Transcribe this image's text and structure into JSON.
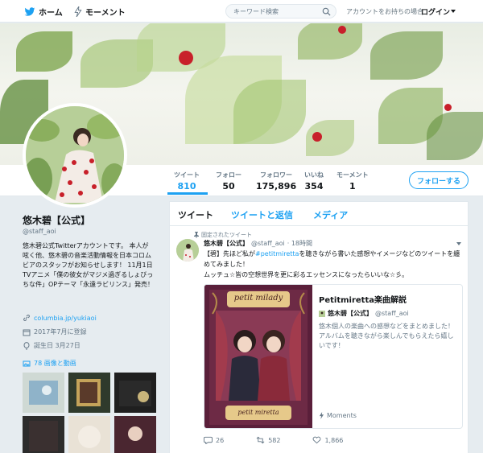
{
  "nav": {
    "home_label": "ホーム",
    "moments_label": "モーメント",
    "search_placeholder": "キーワード検索",
    "login_prompt": "アカウントをお持ちの場合",
    "login_label": "ログイン"
  },
  "stats": [
    {
      "label": "ツイート",
      "value": "810"
    },
    {
      "label": "フォロー",
      "value": "50"
    },
    {
      "label": "フォロワー",
      "value": "175,896"
    },
    {
      "label": "いいね",
      "value": "354"
    },
    {
      "label": "モーメント",
      "value": "1"
    }
  ],
  "follow_button": "フォローする",
  "profile": {
    "name": "悠木碧【公式】",
    "handle": "@staff_aoi",
    "bio": "悠木碧公式Twitterアカウントです。 本人が呟く他、悠木碧の音楽活動情報を日本コロムビアのスタッフがお知らせします！ 11月1日TVアニメ「僕の彼女がマジメ過ぎるしょびっちな件」OPテーマ「永遠ラビリンス」発売！",
    "link": "columbia.jp/yukiaoi",
    "joined": "2017年7月に登録",
    "birthday": "誕生日 3月27日",
    "media_label": "78 画像と動画"
  },
  "timeline": {
    "tabs": [
      "ツイート",
      "ツイートと返信",
      "メディア"
    ],
    "pinned_label": "固定されたツイート",
    "tweet": {
      "name": "悠木碧【公式】",
      "handle": "@staff_aoi",
      "time": "· 18時間",
      "text_pre": "【碧】先ほど私が",
      "hashtag": "#petitmiretta",
      "text_post": "を聴きながら書いた感想やイメージなどのツイートを纏めてみました！",
      "text_line2": "ムッチュ☆皆の空想世界を更に彩るエッセンスになったらいいな☆彡。",
      "card": {
        "title": "Petitmiretta楽曲解説",
        "author_name": "悠木碧【公式】",
        "author_handle": "@staff_aoi",
        "description": "悠木個人の楽曲への感想などをまとめました！アルバムを聴きながら楽しんでもらえたら嬉しいです！",
        "moments_label": "Moments",
        "image_sign_top": "petit milady",
        "image_sign_bottom": "petit miretta"
      },
      "replies": "26",
      "retweets": "582",
      "likes": "1,866"
    }
  },
  "colors": {
    "accent": "#1da1f2",
    "text": "#14171a",
    "muted": "#657786",
    "background": "#e6ecf0"
  }
}
